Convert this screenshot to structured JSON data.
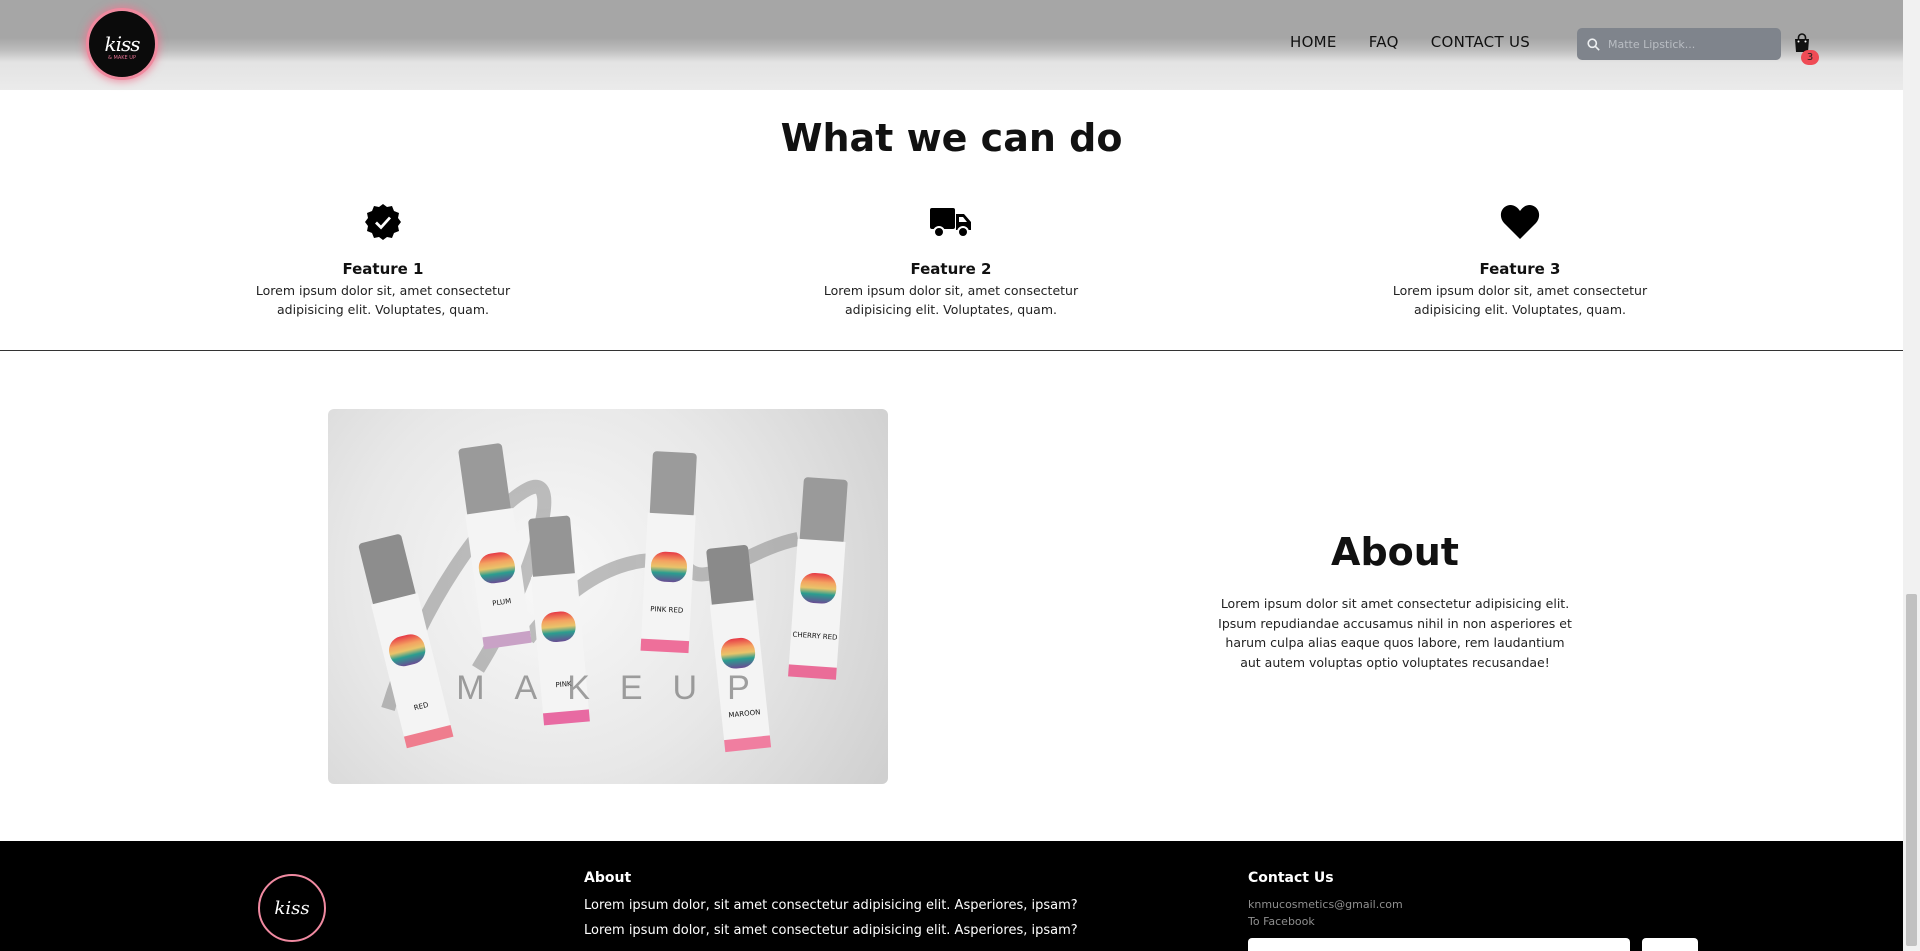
{
  "header": {
    "logo_text": "kiss",
    "logo_sub": "& MAKE UP",
    "nav": [
      "HOME",
      "FAQ",
      "CONTACT US"
    ],
    "search_placeholder": "Matte Lipstick...",
    "cart_count": "3"
  },
  "features": {
    "title": "What we can do",
    "items": [
      {
        "icon": "badge-check-icon",
        "title": "Feature 1",
        "text": "Lorem ipsum dolor sit, amet consectetur adipisicing elit. Voluptates, quam."
      },
      {
        "icon": "truck-icon",
        "title": "Feature 2",
        "text": "Lorem ipsum dolor sit, amet consectetur adipisicing elit. Voluptates, quam."
      },
      {
        "icon": "heart-icon",
        "title": "Feature 3",
        "text": "Lorem ipsum dolor sit, amet consectetur adipisicing elit. Voluptates, quam."
      }
    ]
  },
  "about": {
    "title": "About",
    "text": "Lorem ipsum dolor sit amet consectetur adipisicing elit. Ipsum repudiandae accusamus nihil in non asperiores et harum culpa alias eaque quos labore, rem laudantium aut autem voluptas optio voluptates recusandae!",
    "image_products": [
      "PLUM",
      "RED",
      "PINK",
      "PINK RED",
      "MAROON",
      "CHERRY RED"
    ],
    "image_watermark": "MAKEUP"
  },
  "footer": {
    "logo_text": "kiss",
    "about_title": "About",
    "about_lines": [
      "Lorem ipsum dolor, sit amet consectetur adipisicing elit. Asperiores, ipsam?",
      "Lorem ipsum dolor, sit amet consectetur adipisicing elit. Asperiores, ipsam?"
    ],
    "contact_title": "Contact Us",
    "email": "knmucosmetics@gmail.com",
    "facebook": "To Facebook"
  },
  "colors": {
    "accent_pink": "#ef8a9f",
    "badge_red": "#ef4b55",
    "search_bg": "#7f848c"
  }
}
